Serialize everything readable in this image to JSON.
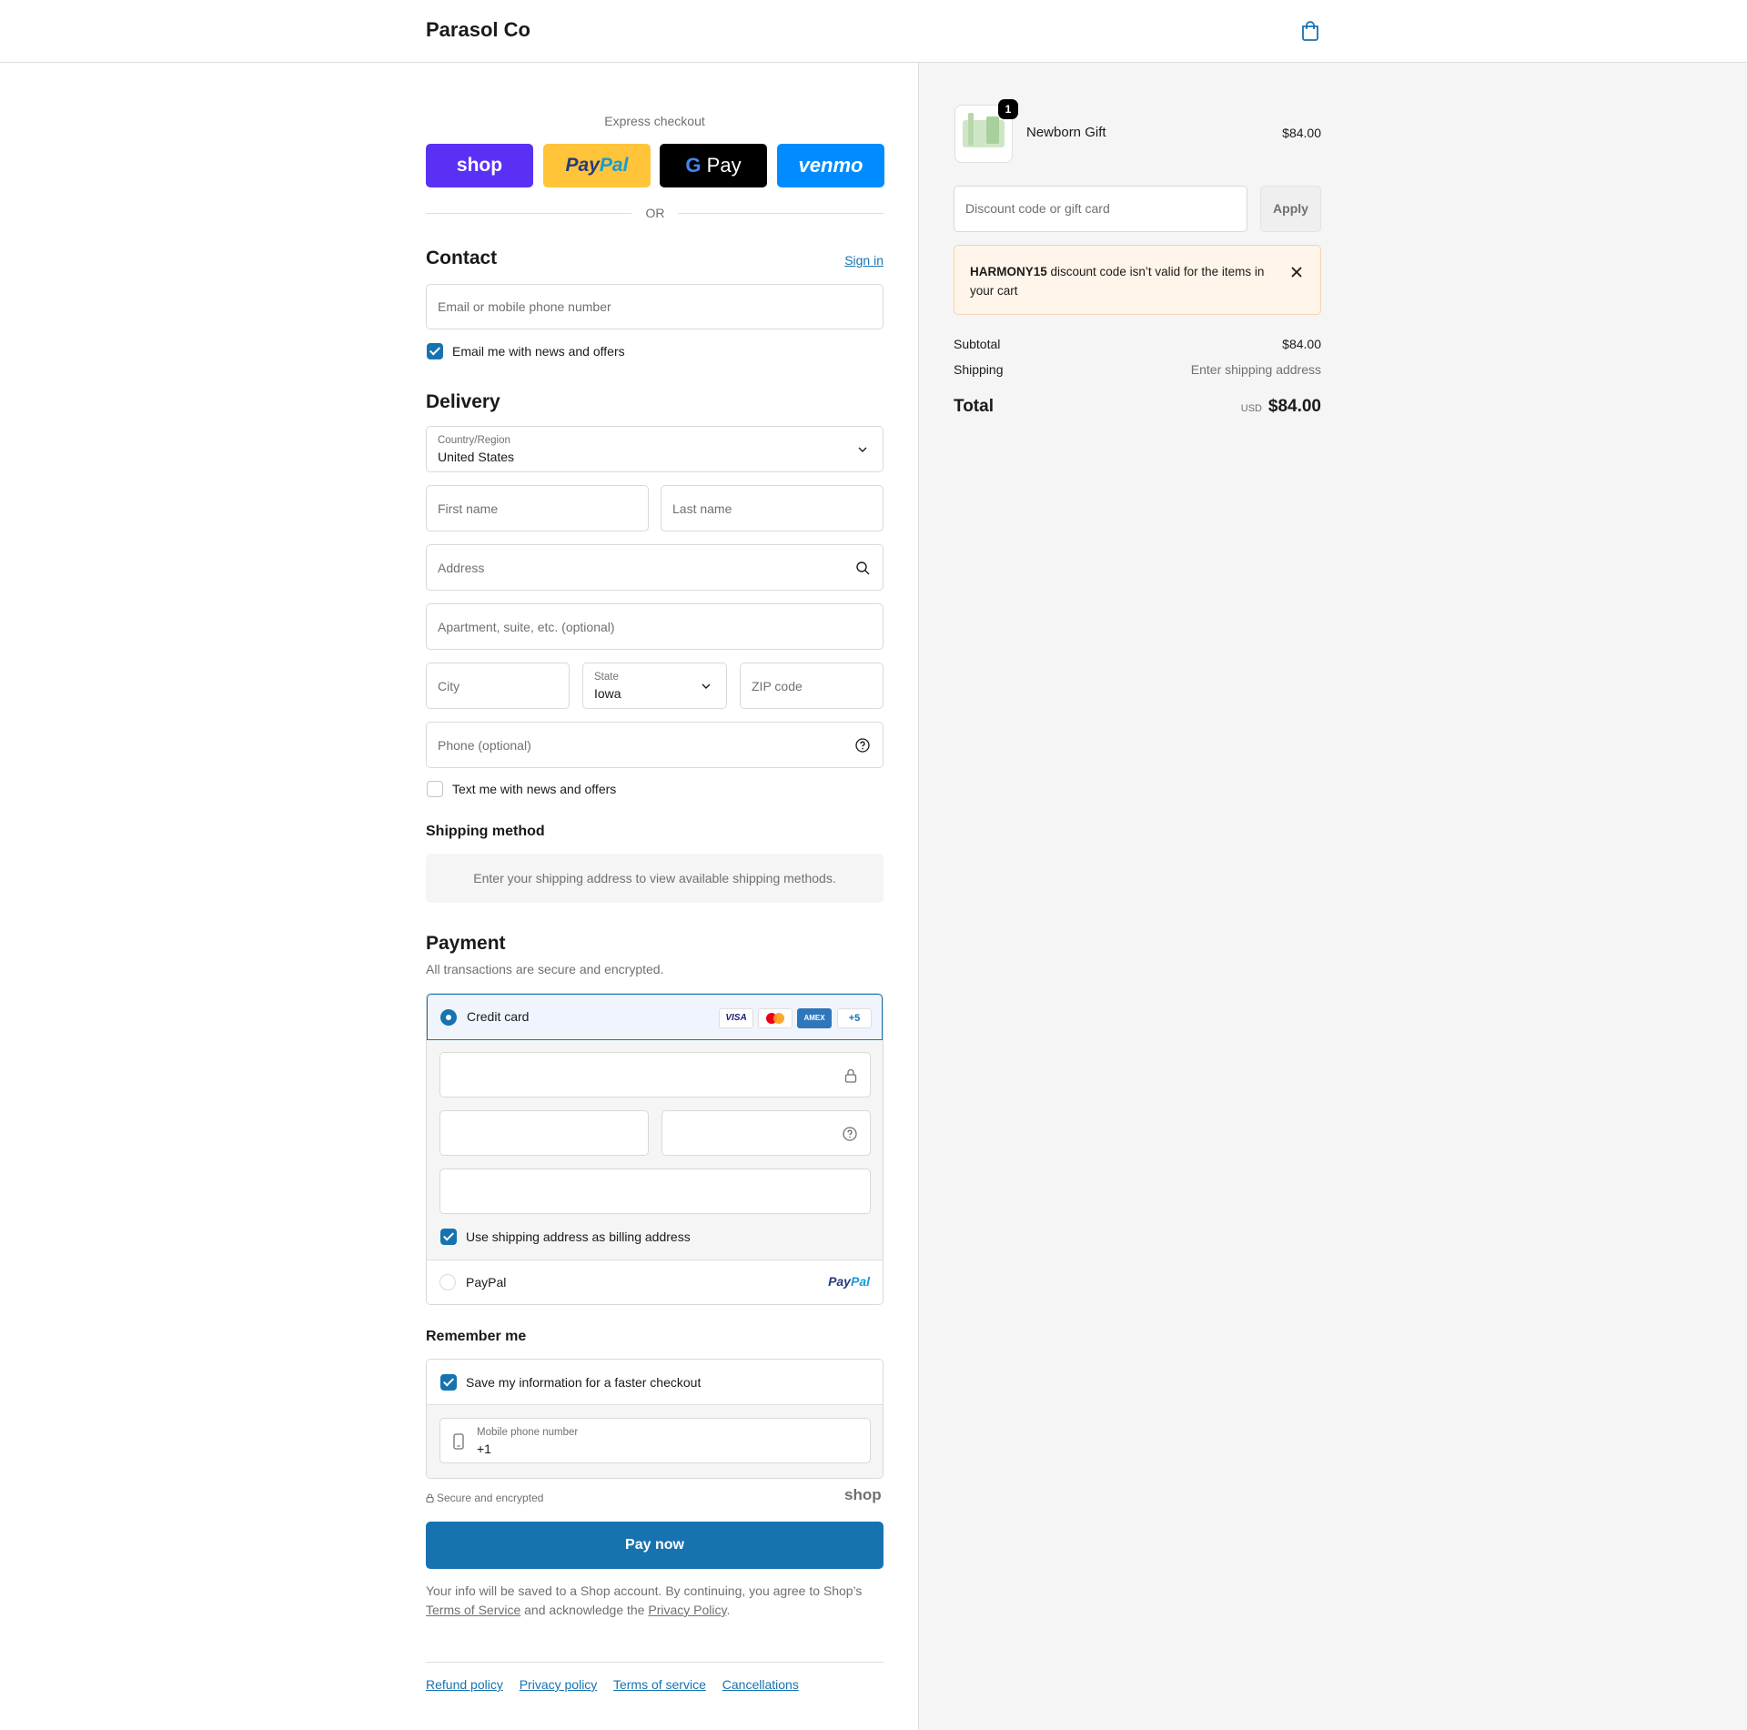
{
  "header": {
    "brand": "Parasol Co",
    "cart_icon": "shopping-bag-icon"
  },
  "express": {
    "title": "Express checkout",
    "buttons": {
      "shop": "shop",
      "paypal_a": "Pay",
      "paypal_b": "Pal",
      "gpay_g": "G",
      "gpay_text": " Pay",
      "venmo": "venmo"
    },
    "or": "OR"
  },
  "contact": {
    "title": "Contact",
    "sign_in": "Sign in",
    "email_placeholder": "Email or mobile phone number",
    "news_label": "Email me with news and offers",
    "news_checked": true
  },
  "delivery": {
    "title": "Delivery",
    "country_label": "Country/Region",
    "country_value": "United States",
    "first_name": "First name",
    "last_name": "Last name",
    "address": "Address",
    "apartment": "Apartment, suite, etc. (optional)",
    "city": "City",
    "state_label": "State",
    "state_value": "Iowa",
    "zip": "ZIP code",
    "phone": "Phone (optional)",
    "text_label": "Text me with news and offers",
    "text_checked": false
  },
  "shipping": {
    "title": "Shipping method",
    "message": "Enter your shipping address to view available shipping methods."
  },
  "payment": {
    "title": "Payment",
    "subtitle": "All transactions are secure and encrypted.",
    "credit_card": "Credit card",
    "cards": {
      "visa": "VISA",
      "amex": "AMEX",
      "more": "+5"
    },
    "billing_label": "Use shipping address as billing address",
    "paypal": "PayPal",
    "paypal_logo_a": "Pay",
    "paypal_logo_b": "Pal"
  },
  "remember": {
    "title": "Remember me",
    "save_label": "Save my information for a faster checkout",
    "mobile_label": "Mobile phone number",
    "mobile_value": "+1"
  },
  "footer": {
    "secure": "Secure and encrypted",
    "shop_mark": "shop",
    "pay_now": "Pay now",
    "legal_1": "Your info will be saved to a Shop account. By continuing, you agree to Shop’s ",
    "terms": "Terms of Service",
    "legal_2": " and acknowledge the ",
    "privacy": "Privacy Policy",
    "legal_3": ".",
    "links": [
      "Refund policy",
      "Privacy policy",
      "Terms of service",
      "Cancellations"
    ]
  },
  "summary": {
    "item": {
      "name": "Newborn Gift",
      "price": "$84.00",
      "qty": "1"
    },
    "discount_placeholder": "Discount code or gift card",
    "apply": "Apply",
    "alert": {
      "code": "HARMONY15",
      "message": " discount code isn’t valid for the items in your cart"
    },
    "subtotal_label": "Subtotal",
    "subtotal_value": "$84.00",
    "shipping_label": "Shipping",
    "shipping_value": "Enter shipping address",
    "total_label": "Total",
    "currency": "USD",
    "total_value": "$84.00"
  },
  "colors": {
    "accent": "#1773b0",
    "shop": "#5a31f4",
    "paypal": "#ffc439",
    "venmo": "#008cff",
    "alert_bg": "#fff5ea"
  }
}
